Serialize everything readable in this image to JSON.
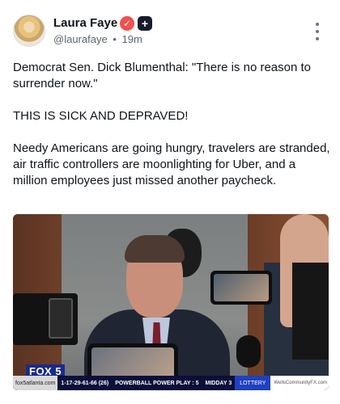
{
  "author": {
    "name": "Laura Faye",
    "handle": "@laurafaye",
    "separator": "•",
    "time": "19m",
    "verified_badge_icon": "check-badge-icon",
    "plus_badge_icon": "plus-badge-icon"
  },
  "post": {
    "paragraphs": [
      "Democrat Sen. Dick Blumenthal: \"There is no reason to surrender now.\"",
      "THIS IS SICK AND DEPRAVED!",
      "Needy Americans are going hungry, travelers are stranded, air traffic controllers are moonlighting for Uber, and a million employees just missed another paycheck."
    ]
  },
  "media": {
    "logo": "FOX 5",
    "ticker": {
      "site": "fox5atlanta.com",
      "item1": "1-17-29-61-66 (26)",
      "item2": "POWERBALL POWER PLAY : 5",
      "item3": "MIDDAY 3",
      "lottery": "LOTTERY",
      "promo": "WellsCommunityFX.com"
    }
  },
  "icons": {
    "more": "more-vertical-icon"
  },
  "colors": {
    "check_badge": "#f0504f",
    "plus_badge": "#1a1a2e",
    "ticker_bg": "#0b0f3a",
    "logo_bg": "#1a2a8a"
  }
}
